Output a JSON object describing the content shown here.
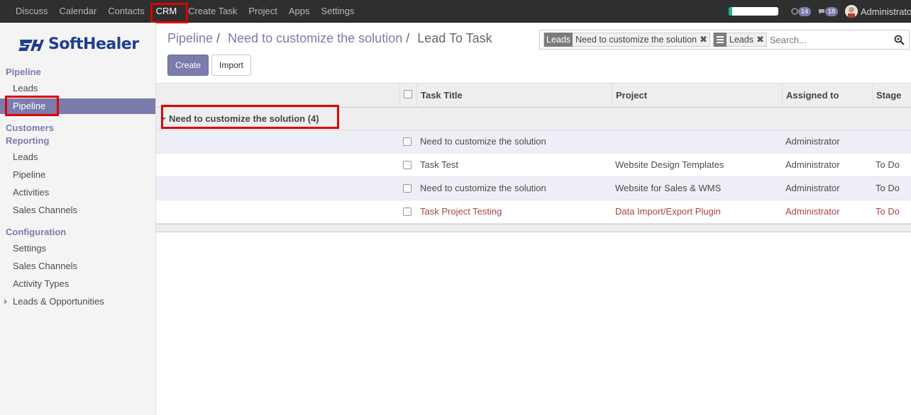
{
  "topbar": {
    "menu": [
      "Discuss",
      "Calendar",
      "Contacts",
      "CRM",
      "Create Task",
      "Project",
      "Apps",
      "Settings"
    ],
    "active_menu": "CRM",
    "activity_count": "14",
    "message_count": "18",
    "user": "Administrator",
    "progress_fraction": 0.07
  },
  "sidebar": {
    "logo": "SoftHealer",
    "sections": {
      "pipeline": "Pipeline",
      "customers": "Customers",
      "reporting": "Reporting",
      "configuration": "Configuration"
    },
    "pipeline_items": [
      "Leads",
      "Pipeline"
    ],
    "reporting_items": [
      "Leads",
      "Pipeline",
      "Activities",
      "Sales Channels"
    ],
    "configuration_items": [
      "Settings",
      "Sales Channels",
      "Activity Types"
    ],
    "extra": "Leads & Opportunities"
  },
  "breadcrumb": {
    "root": "Pipeline",
    "middle": "Need to customize the solution",
    "current": "Lead To Task"
  },
  "buttons": {
    "create": "Create",
    "import": "Import"
  },
  "search": {
    "facet1_category": "Leads",
    "facet1_value": "Need to customize the solution",
    "facet2_value": "Leads",
    "placeholder": "Search..."
  },
  "table": {
    "headers": {
      "title": "Task Title",
      "project": "Project",
      "assigned": "Assigned to",
      "stage": "Stage"
    },
    "group": "Need to customize the solution (4)",
    "rows": [
      {
        "title": "Need to customize the solution",
        "project": "",
        "assigned": "Administrator",
        "stage": ""
      },
      {
        "title": "Task Test",
        "project": "Website Design Templates",
        "assigned": "Administrator",
        "stage": "To Do"
      },
      {
        "title": "Need to customize the solution",
        "project": "Website for Sales & WMS",
        "assigned": "Administrator",
        "stage": "To Do"
      },
      {
        "title": "Task Project Testing",
        "project": "Data Import/Export Plugin",
        "assigned": "Administrator",
        "stage": "To Do"
      }
    ]
  },
  "colors": {
    "accent": "#7c7bad",
    "highlight_box": "#e00000",
    "overdue_text": "#a44444"
  }
}
